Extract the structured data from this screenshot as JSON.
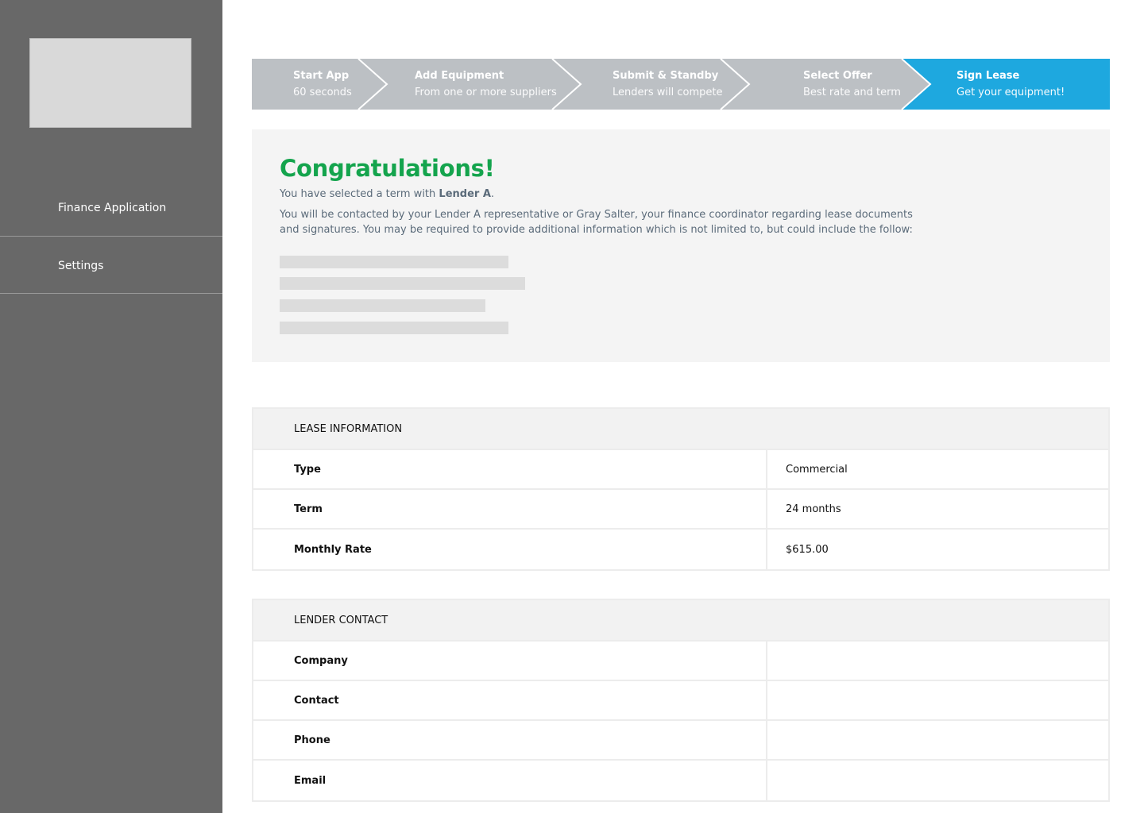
{
  "sidebar": {
    "items": [
      {
        "label": "Finance Application"
      },
      {
        "label": "Settings"
      }
    ]
  },
  "stepper": {
    "inactive_color": "#bcc0c4",
    "active_color": "#1ea8df",
    "steps": [
      {
        "title": "Start App",
        "subtitle": "60 seconds"
      },
      {
        "title": "Add Equipment",
        "subtitle": "From one or more suppliers"
      },
      {
        "title": "Submit & Standby",
        "subtitle": "Lenders will compete"
      },
      {
        "title": "Select Offer",
        "subtitle": "Best rate and term"
      },
      {
        "title": "Sign Lease",
        "subtitle": "Get your equipment!",
        "active": true
      }
    ]
  },
  "congrats": {
    "title": "Congratulations!",
    "selected_prefix": "You have selected a term with ",
    "lender_name": "Lender A",
    "selected_suffix": ".",
    "paragraph": "You will be contacted by your Lender A representative or Gray Salter, your finance coordinator regarding lease documents and signatures. You may be required to provide additional information which is not limited to, but could include the follow:",
    "title_color": "#14a44d"
  },
  "lease_info": {
    "header": "LEASE INFORMATION",
    "rows": [
      {
        "label": "Type",
        "value": "Commercial"
      },
      {
        "label": "Term",
        "value": "24 months"
      },
      {
        "label": "Monthly Rate",
        "value": "$615.00"
      }
    ]
  },
  "lender_contact": {
    "header": "LENDER CONTACT",
    "rows": [
      {
        "label": "Company",
        "value": ""
      },
      {
        "label": "Contact",
        "value": ""
      },
      {
        "label": "Phone",
        "value": ""
      },
      {
        "label": "Email",
        "value": ""
      }
    ]
  }
}
